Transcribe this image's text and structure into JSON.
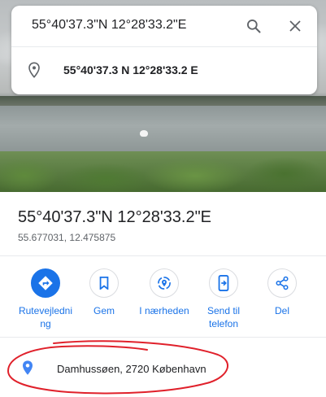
{
  "search": {
    "query": "55°40'37.3\"N 12°28'33.2\"E",
    "suggestion": "55°40'37.3 N 12°28'33.2 E",
    "icons": {
      "search": "search-icon",
      "close": "close-icon",
      "pin": "location-pin-icon"
    }
  },
  "place": {
    "title": "55°40'37.3\"N 12°28'33.2\"E",
    "decimal_coords": "55.677031, 12.475875"
  },
  "actions": [
    {
      "label": "Rutevejledning",
      "icon": "directions-icon",
      "primary": true
    },
    {
      "label": "Gem",
      "icon": "bookmark-icon",
      "primary": false
    },
    {
      "label": "I nærheden",
      "icon": "nearby-icon",
      "primary": false
    },
    {
      "label": "Send til telefon",
      "icon": "send-to-phone-icon",
      "primary": false
    },
    {
      "label": "Del",
      "icon": "share-icon",
      "primary": false
    }
  ],
  "address": {
    "text": "Damhussøen, 2720 København",
    "icon": "location-pin-icon"
  },
  "colors": {
    "accent": "#1a73e8",
    "annotation": "#e0212b",
    "pin": "#4285f4"
  }
}
